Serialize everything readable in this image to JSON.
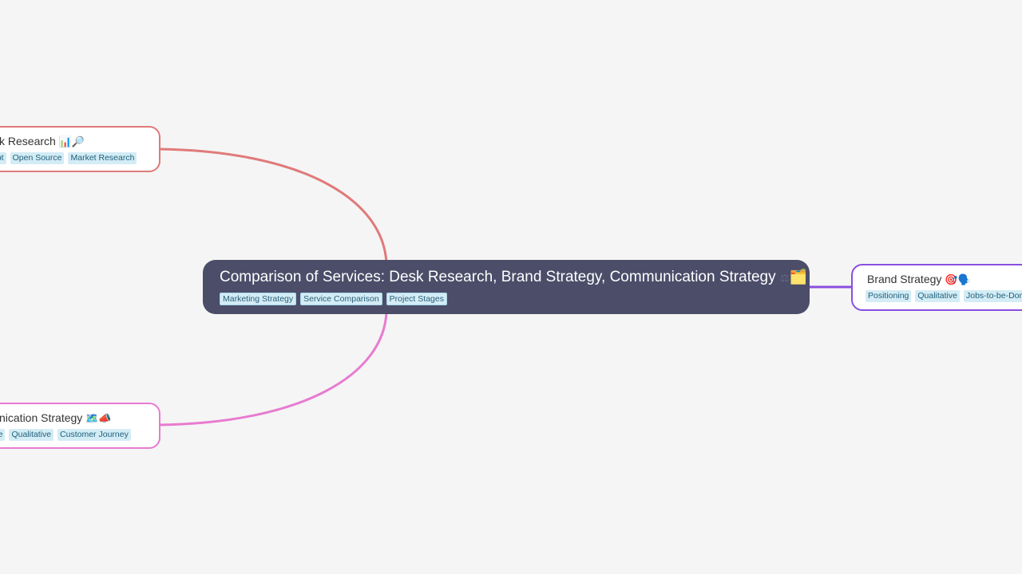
{
  "root": {
    "title": "Comparison of Services: Desk Research, Brand Strategy, Communication Strategy",
    "icons": [
      "scales-icon",
      "folder-icon"
    ],
    "icon_glyphs": [
      "⚖",
      "🗂️"
    ],
    "tags": [
      "Marketing Strategy",
      "Service Comparison",
      "Project Stages"
    ],
    "color": "#4b4d69"
  },
  "branches": [
    {
      "id": "desk-research",
      "title_visible": "k Research",
      "icons": [
        "bar-chart-icon",
        "magnifier-icon"
      ],
      "icon_glyphs": "📊🔎",
      "tags": [
        "ept",
        "Open Source",
        "Market Research"
      ],
      "color": "#e07a7a"
    },
    {
      "id": "communication-strategy",
      "title_visible": "nication Strategy",
      "icons": [
        "map-icon",
        "megaphone-icon"
      ],
      "icon_glyphs": "🗺️📣",
      "tags": [
        "ive",
        "Qualitative",
        "Customer Journey"
      ],
      "color": "#e87bd0"
    },
    {
      "id": "brand-strategy",
      "title_visible": "Brand Strategy",
      "icons": [
        "target-icon",
        "speaking-head-icon"
      ],
      "icon_glyphs": "🎯🗣️",
      "tags": [
        "Positioning",
        "Qualitative",
        "Jobs-to-be-Done"
      ],
      "color": "#8a4ee0"
    }
  ]
}
